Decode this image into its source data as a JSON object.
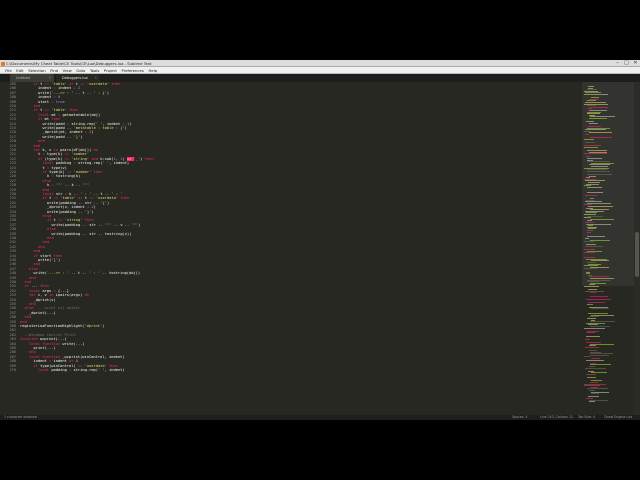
{
  "window": {
    "title": "C:\\Documents\\My Cheat Table\\CE Tools\\CE\\Lua\\Debuggers.lua - Sublime Text",
    "controls": [
      "–",
      "□",
      "✕"
    ]
  },
  "menu": [
    "File",
    "Edit",
    "Selection",
    "Find",
    "View",
    "Goto",
    "Tools",
    "Project",
    "Preferences",
    "Help"
  ],
  "tabs": [
    {
      "label": "Untitled",
      "active": false
    },
    {
      "label": "Debuggers.lua",
      "active": true
    }
  ],
  "status": {
    "left": "1 character selected",
    "spaces": "Spaces: 4",
    "tabsize": "Tab Size: 4",
    "syntax": "Cheat Engine Lua",
    "position": "Line 243, Column 12"
  },
  "gutter_start": 205,
  "code_lines": [
    [
      [
        "if ",
        "kw"
      ],
      [
        "t ",
        ""
      ],
      [
        "== ",
        "kw"
      ],
      [
        "'table' ",
        "st"
      ],
      [
        "or ",
        "kw"
      ],
      [
        "t ",
        ""
      ],
      [
        "== ",
        "kw"
      ],
      [
        "'userdata' ",
        "st"
      ],
      [
        "then",
        "kw"
      ]
    ],
    [
      [
        "indent ",
        ""
      ],
      [
        "= ",
        "kw"
      ],
      [
        "indent ",
        ""
      ],
      [
        "+ ",
        "kw"
      ],
      [
        "2",
        "nm"
      ]
    ],
    [
      [
        "write",
        ""
      ],
      [
        "(",
        ""
      ],
      [
        "'--->> : '",
        ""
      ],
      [
        " .. t .. ",
        ""
      ],
      [
        "' : {'",
        ""
      ],
      [
        ")",
        ""
      ]
    ],
    [
      [
        "indent ",
        ""
      ],
      [
        "= ",
        "kw"
      ],
      [
        "0",
        "nm"
      ]
    ],
    [
      [
        "start ",
        ""
      ],
      [
        "= ",
        "kw"
      ],
      [
        "true",
        "nm"
      ]
    ],
    [
      [
        "end",
        "kw"
      ]
    ],
    [
      [
        "if ",
        "kw"
      ],
      [
        "t ",
        ""
      ],
      [
        "== ",
        "kw"
      ],
      [
        "'table' ",
        "st"
      ],
      [
        "then",
        "kw"
      ]
    ],
    [
      [
        "local ",
        "kw"
      ],
      [
        "mt ",
        ""
      ],
      [
        "= ",
        "kw"
      ],
      [
        "getmetatable",
        ""
      ],
      [
        "(obj)",
        ""
      ]
    ],
    [
      [
        "if ",
        "kw"
      ],
      [
        "mt ",
        ""
      ],
      [
        "then",
        "kw"
      ]
    ],
    [
      [
        "write",
        ""
      ],
      [
        "(padd ",
        ""
      ],
      [
        "= ",
        "kw"
      ],
      [
        "string",
        ""
      ],
      [
        ".rep(",
        ""
      ],
      [
        "' '",
        ""
      ],
      [
        ", indent ",
        ""
      ],
      [
        "+ ",
        "kw"
      ],
      [
        "1",
        "nm"
      ],
      [
        ")",
        ""
      ]
    ],
    [
      [
        "write",
        ""
      ],
      [
        "(padd .. ",
        ""
      ],
      [
        "'metatable : table : {'",
        ""
      ],
      [
        ")",
        ""
      ]
    ],
    [
      [
        "_dprint(mt, indent ",
        ""
      ],
      [
        "+ ",
        "kw"
      ],
      [
        "2",
        "nm"
      ],
      [
        ")",
        ""
      ]
    ],
    [
      [
        "write",
        ""
      ],
      [
        "(padd .. ",
        ""
      ],
      [
        "'}'",
        ""
      ],
      [
        ")",
        ""
      ]
    ],
    [
      [
        "end",
        "kw"
      ]
    ],
    [
      [
        "end",
        "kw"
      ]
    ],
    [
      [
        "for ",
        "kw"
      ],
      [
        "k, v ",
        ""
      ],
      [
        "in ",
        "kw"
      ],
      [
        "pairs",
        ""
      ],
      [
        "(",
        ""
      ],
      [
        "dF(obj)",
        ""
      ],
      [
        ") ",
        ""
      ],
      [
        "do",
        "kw"
      ]
    ],
    [
      [
        "t ",
        ""
      ],
      [
        "= ",
        "kw"
      ],
      [
        "type",
        ""
      ],
      [
        "(k) ",
        ""
      ],
      [
        "== ",
        "kw"
      ],
      [
        "'number'",
        "st"
      ]
    ],
    [
      [
        "if ",
        "kw"
      ],
      [
        "(type(k) ",
        ""
      ],
      [
        "== ",
        "kw"
      ],
      [
        "'string' ",
        "st"
      ],
      [
        "and ",
        "kw"
      ],
      [
        "k:sub(",
        ""
      ],
      [
        "1",
        "nm"
      ],
      [
        ", ",
        ""
      ],
      [
        "1",
        "nm"
      ],
      [
        ") ",
        ""
      ],
      [
        "== ",
        "hl"
      ],
      [
        "'_'",
        ""
      ],
      [
        ") ",
        ""
      ],
      [
        "then",
        "kw"
      ]
    ],
    [
      [
        "local ",
        "kw"
      ],
      [
        "padding ",
        ""
      ],
      [
        "= ",
        "kw"
      ],
      [
        "string",
        ""
      ],
      [
        ".rep(",
        ""
      ],
      [
        "' '",
        ""
      ],
      [
        ", indent)",
        ""
      ]
    ],
    [
      [
        "t ",
        ""
      ],
      [
        "= ",
        "kw"
      ],
      [
        "type",
        ""
      ],
      [
        "(v)",
        ""
      ]
    ],
    [
      [
        "if ",
        "kw"
      ],
      [
        "type",
        ""
      ],
      [
        "(k) ",
        ""
      ],
      [
        "== ",
        "kw"
      ],
      [
        "'number' ",
        "st"
      ],
      [
        "then",
        "kw"
      ]
    ],
    [
      [
        "k ",
        ""
      ],
      [
        "= ",
        "kw"
      ],
      [
        "tostring",
        ""
      ],
      [
        "(k)",
        ""
      ]
    ],
    [
      [
        "else",
        "kw"
      ]
    ],
    [
      [
        "k ",
        ""
      ],
      [
        "= ",
        "kw"
      ],
      [
        "'\"' ",
        ""
      ],
      [
        ".. k .. ",
        ""
      ],
      [
        "'\"'",
        ""
      ]
    ],
    [
      [
        "end",
        "kw"
      ]
    ],
    [
      [
        "local ",
        "kw"
      ],
      [
        "str ",
        ""
      ],
      [
        "= ",
        "kw"
      ],
      [
        "k .. ",
        ""
      ],
      [
        "' : ' ",
        ""
      ],
      [
        ".. t .. ",
        ""
      ],
      [
        "' : '",
        ""
      ]
    ],
    [
      [
        "if ",
        "kw"
      ],
      [
        "t ",
        ""
      ],
      [
        "== ",
        "kw"
      ],
      [
        "'table' ",
        "st"
      ],
      [
        "or ",
        "kw"
      ],
      [
        "t ",
        ""
      ],
      [
        "== ",
        "kw"
      ],
      [
        "'userdata' ",
        "st"
      ],
      [
        "then",
        "kw"
      ]
    ],
    [
      [
        "write",
        ""
      ],
      [
        "(padding .. str .. ",
        ""
      ],
      [
        "'{'",
        ""
      ],
      [
        ")",
        ""
      ]
    ],
    [
      [
        "_dprint(v, indent ",
        ""
      ],
      [
        "+ ",
        "kw"
      ],
      [
        "2",
        "nm"
      ],
      [
        ")",
        ""
      ]
    ],
    [
      [
        "write",
        ""
      ],
      [
        "(padding .. ",
        ""
      ],
      [
        "'}'",
        ""
      ],
      [
        ")",
        ""
      ]
    ],
    [
      [
        "else",
        "kw"
      ]
    ],
    [
      [
        "if ",
        "kw"
      ],
      [
        "t ",
        ""
      ],
      [
        "== ",
        "kw"
      ],
      [
        "'string' ",
        "st"
      ],
      [
        "then",
        "kw"
      ]
    ],
    [
      [
        "write",
        ""
      ],
      [
        "(padding .. str .. ",
        ""
      ],
      [
        "'\"' ",
        ""
      ],
      [
        ".. v .. ",
        ""
      ],
      [
        "'\"'",
        ""
      ],
      [
        ")",
        ""
      ]
    ],
    [
      [
        "else",
        "kw"
      ]
    ],
    [
      [
        "write",
        ""
      ],
      [
        "(padding .. str .. ",
        ""
      ],
      [
        "tostring",
        ""
      ],
      [
        "(v))",
        ""
      ]
    ],
    [
      [
        "end",
        "kw"
      ]
    ],
    [
      [
        "end",
        "kw"
      ]
    ],
    [
      [
        "end",
        "kw"
      ]
    ],
    [
      [
        "end",
        "kw"
      ]
    ],
    [
      [
        "if ",
        "kw"
      ],
      [
        "start ",
        ""
      ],
      [
        "then",
        "kw"
      ]
    ],
    [
      [
        "write",
        ""
      ],
      [
        "(",
        ""
      ],
      [
        "'}'",
        ""
      ],
      [
        ")",
        ""
      ]
    ],
    [
      [
        "end",
        "kw"
      ]
    ],
    [
      [
        "else",
        "kw"
      ]
    ],
    [
      [
        "write",
        ""
      ],
      [
        "(",
        ""
      ],
      [
        "'--->> : ' ",
        ""
      ],
      [
        ".. t .. ",
        ""
      ],
      [
        "' : ' ",
        ""
      ],
      [
        ".. ",
        ""
      ],
      [
        "tostring",
        ""
      ],
      [
        "(obj))",
        ""
      ]
    ],
    [
      [
        "end",
        "kw"
      ]
    ],
    [
      [
        "end",
        "kw"
      ]
    ],
    [
      [
        "if ",
        "kw"
      ],
      [
        "... ",
        ""
      ],
      [
        "then",
        "kw"
      ]
    ],
    [
      [
        "local ",
        "kw"
      ],
      [
        "args ",
        ""
      ],
      [
        "= ",
        "kw"
      ],
      [
        "{...}",
        ""
      ]
    ],
    [
      [
        "for ",
        "kw"
      ],
      [
        "i, v ",
        ""
      ],
      [
        "in ",
        "kw"
      ],
      [
        "ipairs",
        ""
      ],
      [
        "(args) ",
        ""
      ],
      [
        "do",
        "kw"
      ]
    ],
    [
      [
        "_dprint(v)",
        ""
      ]
    ],
    [
      [
        "end",
        "kw"
      ]
    ],
    [
      [
        "else",
        "kw"
      ],
      [
        "  -- print nil object",
        "cm"
      ]
    ],
    [
      [
        "_dprint(...)",
        ""
      ]
    ],
    [
      [
        "end",
        "kw"
      ]
    ],
    [
      [
        "end",
        "kw"
      ]
    ],
    [
      [
        "registerLuaFunctionHighlight",
        ""
      ],
      [
        "(",
        ""
      ],
      [
        "'dprint'",
        ""
      ],
      [
        ")",
        ""
      ]
    ],
    [
      [
        "",
        ""
      ]
    ],
    [
      [
        "--Windows Control Print",
        "cm"
      ]
    ],
    [
      [
        "function ",
        "kw"
      ],
      [
        "wcprint",
        ""
      ],
      [
        "(...)",
        ""
      ]
    ],
    [
      [
        "local ",
        "kw"
      ],
      [
        "function ",
        "kw"
      ],
      [
        "write",
        ""
      ],
      [
        "(...)",
        ""
      ]
    ],
    [
      [
        "print",
        ""
      ],
      [
        "(...)",
        ""
      ]
    ],
    [
      [
        "end",
        "kw"
      ]
    ],
    [
      [
        "local ",
        "kw"
      ],
      [
        "function ",
        "kw"
      ],
      [
        "_wcprint",
        ""
      ],
      [
        "(winControl, indent)",
        ""
      ]
    ],
    [
      [
        "indent ",
        ""
      ],
      [
        "= ",
        "kw"
      ],
      [
        "indent ",
        ""
      ],
      [
        "or ",
        "kw"
      ],
      [
        "0",
        "nm"
      ]
    ],
    [
      [
        "if ",
        "kw"
      ],
      [
        "type",
        ""
      ],
      [
        "(winControl) ",
        ""
      ],
      [
        "== ",
        "kw"
      ],
      [
        "'userdata' ",
        "st"
      ],
      [
        "then",
        "kw"
      ]
    ],
    [
      [
        "local ",
        "kw"
      ],
      [
        "padding ",
        ""
      ],
      [
        "= ",
        "kw"
      ],
      [
        "string",
        ""
      ],
      [
        ".rep(' ', indent)",
        ""
      ]
    ]
  ],
  "code_indents": [
    6,
    8,
    8,
    8,
    8,
    6,
    6,
    8,
    8,
    10,
    10,
    10,
    10,
    8,
    6,
    6,
    8,
    8,
    10,
    10,
    10,
    12,
    10,
    12,
    10,
    10,
    10,
    12,
    12,
    12,
    10,
    12,
    14,
    12,
    14,
    12,
    10,
    8,
    6,
    6,
    8,
    6,
    4,
    6,
    4,
    2,
    2,
    4,
    4,
    6,
    4,
    2,
    4,
    2,
    0,
    0,
    0,
    2,
    0,
    4,
    6,
    4,
    4,
    6,
    6,
    8
  ]
}
